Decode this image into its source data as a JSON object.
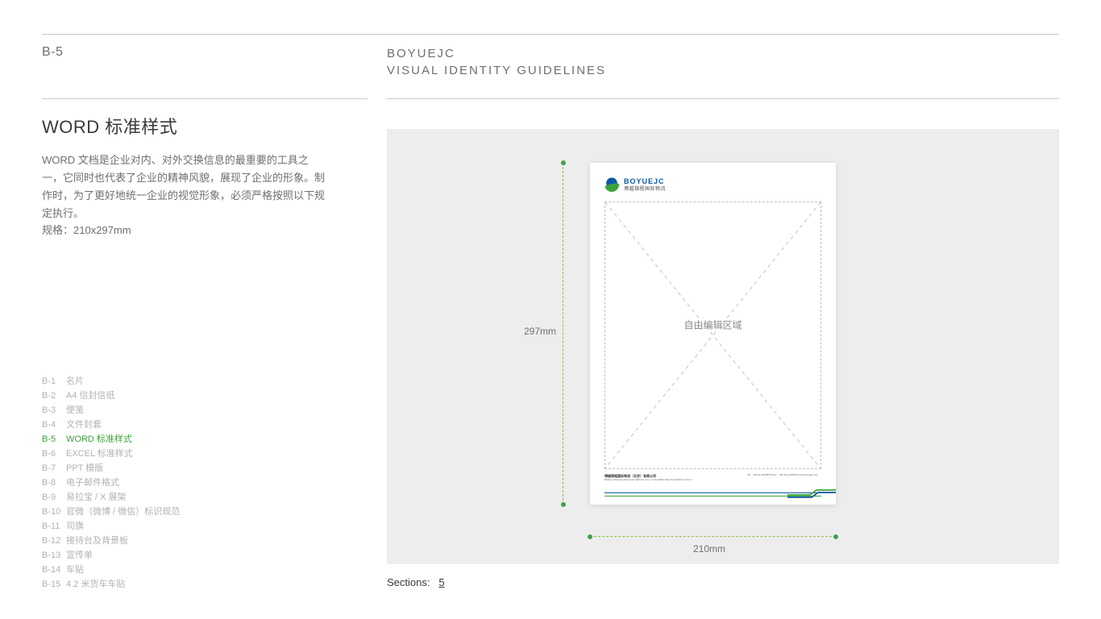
{
  "header": {
    "code": "B-5",
    "brand": "BOYUEJC",
    "subtitle": "VISUAL IDENTITY GUIDELINES"
  },
  "title": "WORD 标准样式",
  "body": "WORD 文档是企业对内、对外交换信息的最重要的工具之一，它同时也代表了企业的精神风貌，展现了企业的形象。制作时，为了更好地统一企业的视觉形象，必须严格按照以下规定执行。",
  "spec": "规格：210x297mm",
  "toc": [
    {
      "code": "B-1",
      "label": "名片"
    },
    {
      "code": "B-2",
      "label": "A4 信封信纸"
    },
    {
      "code": "B-3",
      "label": "便笺"
    },
    {
      "code": "B-4",
      "label": "文件封套"
    },
    {
      "code": "B-5",
      "label": "WORD 标准样式",
      "active": true
    },
    {
      "code": "B-6",
      "label": "EXCEL 标准样式"
    },
    {
      "code": "B-7",
      "label": "PPT 模版"
    },
    {
      "code": "B-8",
      "label": "电子邮件格式"
    },
    {
      "code": "B-9",
      "label": "易拉宝 / X 展架"
    },
    {
      "code": "B-10",
      "label": "官微（微博 / 微信）标识规范"
    },
    {
      "code": "B-11",
      "label": "司旗"
    },
    {
      "code": "B-12",
      "label": "接待台及背景板"
    },
    {
      "code": "B-13",
      "label": "宣传单"
    },
    {
      "code": "B-14",
      "label": "车贴"
    },
    {
      "code": "B-15",
      "label": "4.2 米货车车贴"
    }
  ],
  "mock": {
    "logo_en": "BOYUEJC",
    "logo_cn": "博越锦程国际物流",
    "edit_label": "自由编辑区域",
    "dim_width": "210mm",
    "dim_height": "297mm",
    "footer_company": "博越锦程国际物流（北京）有限公司",
    "footer_addr": "Beijing Chaoyang Reserved Address Line 1\nCompatible Reserved Address Line 2",
    "footer_contact": "Tel：+86-10-12345678    Fax：+86-10-12345679\nwww.boyuejc.com"
  },
  "sections": {
    "label": "Sections:",
    "value": "5"
  },
  "colors": {
    "green": "#3da23a",
    "blue": "#0b5aa6",
    "grey": "#6f6f6f"
  }
}
